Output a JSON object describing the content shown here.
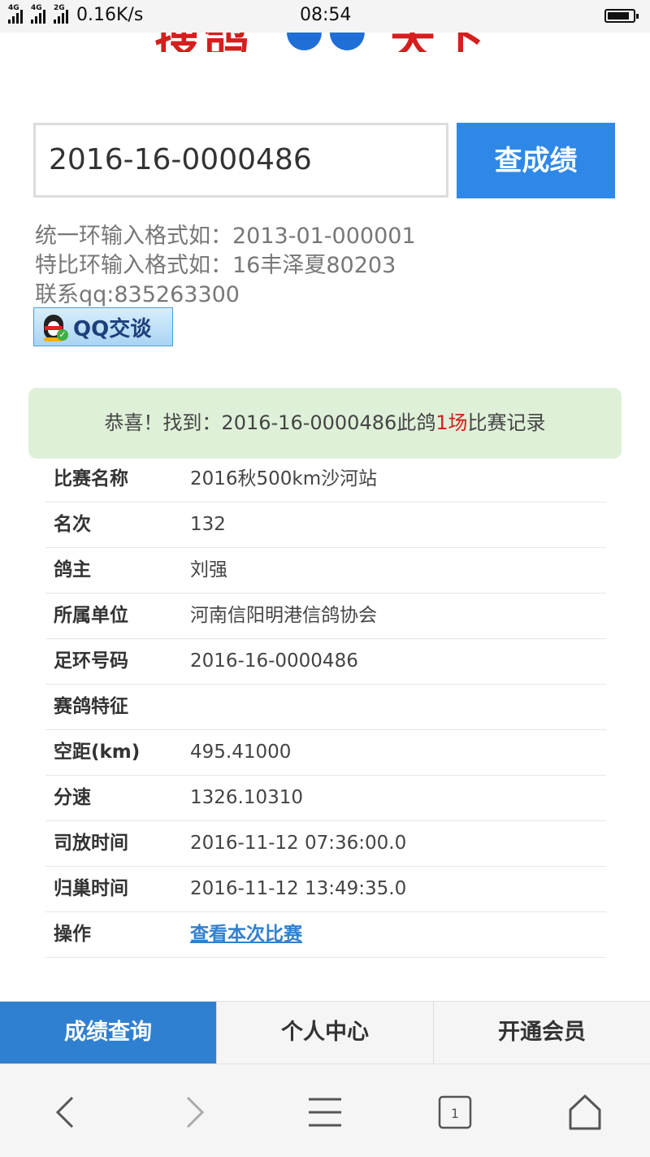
{
  "status_bar": {
    "network_label_1": "4G",
    "network_label_2": "4G",
    "network_label_3": "2G",
    "speed": "0.16K/s",
    "time": "08:54"
  },
  "header": {
    "logo_text_left": "搜鸽",
    "logo_text_right": "天下"
  },
  "search": {
    "value": "2016-16-0000486",
    "button_label": "查成绩"
  },
  "hints": {
    "line1": "统一环输入格式如：2013-01-000001",
    "line2": "特比环输入格式如：16丰泽夏80203",
    "contact": "联系qq:835263300",
    "qq_button": "QQ交谈"
  },
  "result": {
    "prefix": "恭喜！找到：2016-16-0000486此鸽",
    "count": "1场",
    "suffix": "比赛记录"
  },
  "record": [
    {
      "label": "比赛名称",
      "value": "2016秋500km沙河站"
    },
    {
      "label": "名次",
      "value": "132"
    },
    {
      "label": "鸽主",
      "value": "刘强"
    },
    {
      "label": "所属单位",
      "value": "河南信阳明港信鸽协会"
    },
    {
      "label": "足环号码",
      "value": "2016-16-0000486"
    },
    {
      "label": "赛鸽特征",
      "value": ""
    },
    {
      "label": "空距(km)",
      "value": "495.41000"
    },
    {
      "label": "分速",
      "value": "1326.10310"
    },
    {
      "label": "司放时间",
      "value": "2016-11-12 07:36:00.0"
    },
    {
      "label": "归巢时间",
      "value": "2016-11-12 13:49:35.0"
    },
    {
      "label": "操作",
      "value": "查看本次比赛"
    }
  ],
  "bottom_nav": [
    {
      "label": "成绩查询",
      "active": true
    },
    {
      "label": "个人中心",
      "active": false
    },
    {
      "label": "开通会员",
      "active": false
    }
  ],
  "browser_toolbar": {
    "tab_count": "1",
    "icons": [
      "back-icon",
      "forward-icon",
      "menu-icon",
      "tabs-icon",
      "home-icon"
    ]
  },
  "colors": {
    "accent": "#2f88e8",
    "success_bg": "#dff0d8",
    "highlight": "#d02020",
    "link": "#2f80d0"
  }
}
